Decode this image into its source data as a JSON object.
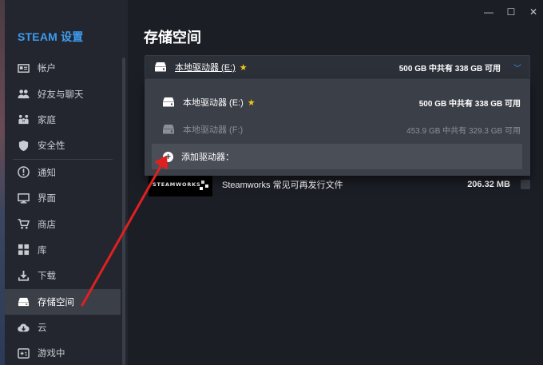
{
  "app": {
    "title": "STEAM 设置"
  },
  "window_controls": {
    "minimize": "—",
    "maximize": "☐",
    "close": "✕"
  },
  "sidebar": {
    "items": [
      {
        "label": "帐户",
        "icon": "account-card-icon"
      },
      {
        "label": "好友与聊天",
        "icon": "friends-icon"
      },
      {
        "label": "家庭",
        "icon": "family-icon"
      },
      {
        "label": "安全性",
        "icon": "shield-icon"
      },
      {
        "label": "通知",
        "icon": "notification-icon"
      },
      {
        "label": "界面",
        "icon": "monitor-icon"
      },
      {
        "label": "商店",
        "icon": "store-icon"
      },
      {
        "label": "库",
        "icon": "library-grid-icon"
      },
      {
        "label": "下载",
        "icon": "download-icon"
      },
      {
        "label": "存储空间",
        "icon": "drive-icon",
        "active": true
      },
      {
        "label": "云",
        "icon": "cloud-icon"
      },
      {
        "label": "游戏中",
        "icon": "gamepad-icon"
      }
    ]
  },
  "main": {
    "title": "存储空间",
    "selected_drive": {
      "name": "本地驱动器 (E:)",
      "space": "500 GB 中共有 338 GB 可用"
    },
    "dropdown": {
      "items": [
        {
          "name": "本地驱动器 (E:)",
          "space": "500 GB 中共有 338 GB 可用",
          "default": true
        },
        {
          "name": "本地驱动器 (F:)",
          "space": "453.9 GB 中共有 329.3 GB 可用",
          "default": false
        }
      ],
      "add_label": "添加驱动器："
    },
    "game": {
      "logo_text": "STEAMWORKS",
      "name": "Steamworks 常见可再发行文件",
      "size": "206.32 MB"
    }
  },
  "colors": {
    "accent": "#3d9cf0",
    "star": "#f5c518",
    "annotation_arrow": "#e02020"
  }
}
